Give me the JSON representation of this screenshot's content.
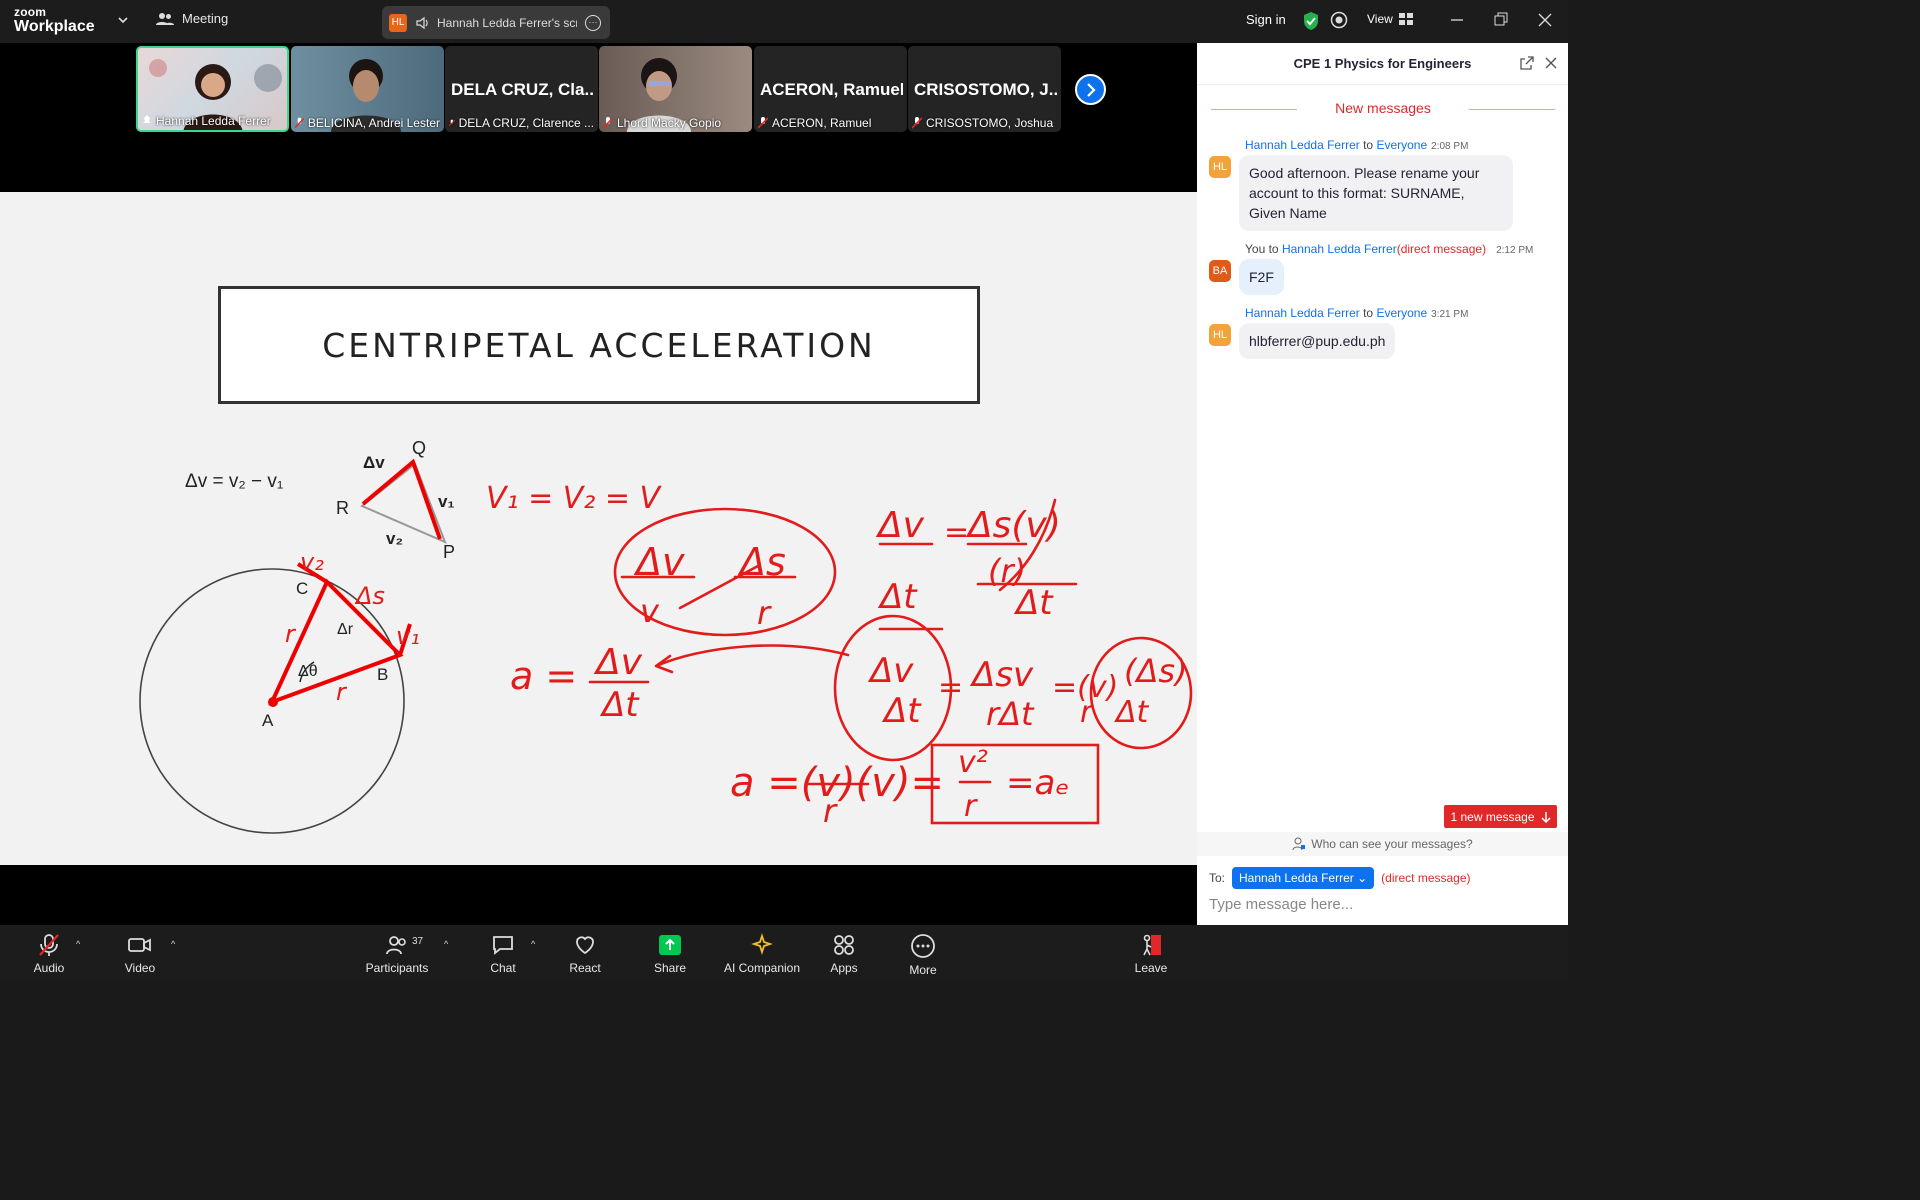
{
  "app": {
    "logo_line1": "zoom",
    "logo_line2": "Workplace"
  },
  "topbar": {
    "meeting_label": "Meeting",
    "share_initials": "HL",
    "share_label": "Hannah Ledda Ferrer's screen",
    "signin_label": "Sign in",
    "view_label": "View"
  },
  "gallery": {
    "tiles": [
      {
        "name": "Hannah Ledda Ferrer",
        "big": ""
      },
      {
        "name": "BELICINA, Andrei Lester",
        "big": ""
      },
      {
        "name": "DELA CRUZ, Clarence ...",
        "big": "DELA CRUZ, Cla..."
      },
      {
        "name": "Lhord Macky Gopio",
        "big": ""
      },
      {
        "name": "ACERON, Ramuel",
        "big": "ACERON, Ramuel"
      },
      {
        "name": "CRISOSTOMO, Joshua",
        "big": "CRISOSTOMO, J..."
      }
    ]
  },
  "slide": {
    "title": "CENTRIPETAL ACCELERATION",
    "diagram_labels": {
      "dv_eq": "Δv = v₂ − v₁",
      "Q": "Q",
      "R": "R",
      "P": "P",
      "dv": "Δv",
      "v1": "v₁",
      "v2": "v₂",
      "C": "C",
      "B": "B",
      "A": "A",
      "dr": "Δr",
      "dtheta": "Δθ",
      "r": "r"
    }
  },
  "chat": {
    "title": "CPE 1 Physics for Engineers",
    "new_messages_label": "New messages",
    "messages": [
      {
        "initials": "HL",
        "sender": "Hannah Ledda Ferrer",
        "to_word": "to",
        "recipient": "Everyone",
        "dm": "",
        "time": "2:08 PM",
        "text": "Good afternoon. Please rename your account to this format: SURNAME, Given Name"
      },
      {
        "initials": "BA",
        "sender": "You",
        "to_word": "to",
        "recipient": "Hannah Ledda Ferrer",
        "dm": "(direct message)",
        "time": "2:12 PM",
        "text": "F2F"
      },
      {
        "initials": "HL",
        "sender": "Hannah Ledda Ferrer",
        "to_word": "to",
        "recipient": "Everyone",
        "dm": "",
        "time": "3:21 PM",
        "text": "hlbferrer@pup.edu.ph"
      }
    ],
    "new_count_label": "1 new message",
    "who_can_see": "Who can see your messages?",
    "to_label": "To:",
    "recipient": "Hannah Ledda Ferrer",
    "dm_label": "(direct message)",
    "input_placeholder": "Type message here..."
  },
  "toolbar": {
    "audio": "Audio",
    "video": "Video",
    "participants": "Participants",
    "participants_count": "37",
    "chat": "Chat",
    "react": "React",
    "share": "Share",
    "ai": "AI Companion",
    "apps": "Apps",
    "more": "More",
    "leave": "Leave"
  },
  "colors": {
    "accent": "#0e72ed",
    "red": "#e02828",
    "share_green": "#00c853",
    "active_border": "#3ed68a"
  }
}
